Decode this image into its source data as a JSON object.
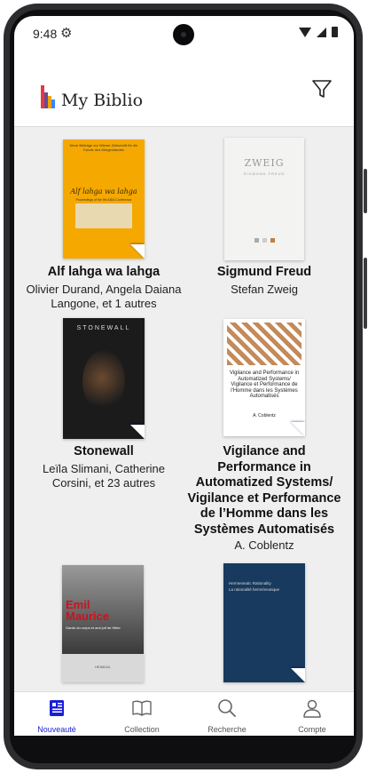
{
  "status": {
    "time": "9:48"
  },
  "header": {
    "app_title": "My Biblio"
  },
  "books": [
    {
      "title": "Alf lahga wa lahga",
      "authors": "Olivier Durand, Angela Daiana Langone, et 1 autres",
      "cover": {
        "color": "#f5a800",
        "text_lines": [
          "Neue Beiträge zur Wiener Zeitschrift für die Kunde des Morgenlandes",
          "Alf lahga wa lahga",
          "Proceedings of the 9th AIDA Conference"
        ]
      }
    },
    {
      "title": "Sigmund Freud",
      "authors": "Stefan Zweig",
      "cover": {
        "color": "#f3f3f1",
        "text_lines": [
          "ZWEIG",
          "SIGMUND FREUD"
        ]
      }
    },
    {
      "title": "Stonewall",
      "authors": "Leïla Slimani, Catherine Corsini, et 23 autres",
      "cover": {
        "color": "#1b1b1b",
        "text_lines": [
          "STONEWALL"
        ]
      }
    },
    {
      "title": "Vigilance and Performance in Automatized Systems/ Vigilance et Performance de l’Homme dans les Systèmes Automatisés",
      "authors": "A. Coblentz",
      "cover": {
        "color": "#ffffff",
        "text_lines": [
          "Vigilance and Performance in Automatized Systems/ Vigilance et Performance de l'Homme dans les Systèmes Automatisés",
          "A. Coblentz"
        ]
      }
    },
    {
      "title": "",
      "authors": "",
      "cover": {
        "color": "#d9d9d9",
        "text_lines": [
          "Emil Maurice",
          "Garde du corps et ami juif de Hitler",
          "HEIMDAL"
        ]
      }
    },
    {
      "title": "",
      "authors": "",
      "cover": {
        "color": "#173a5e",
        "text_lines": [
          "Hermeneutic Rationality",
          "La rationalité herméneutique"
        ]
      }
    }
  ],
  "nav": [
    {
      "label": "Nouveauté",
      "icon": "newspaper-icon",
      "active": true
    },
    {
      "label": "Collection",
      "icon": "book-icon",
      "active": false
    },
    {
      "label": "Recherche",
      "icon": "search-icon",
      "active": false
    },
    {
      "label": "Compte",
      "icon": "person-icon",
      "active": false
    }
  ],
  "colors": {
    "accent": "#1a1fd6",
    "logo": [
      "#e63946",
      "#6a4c93",
      "#f4a300",
      "#3a86ff"
    ]
  }
}
